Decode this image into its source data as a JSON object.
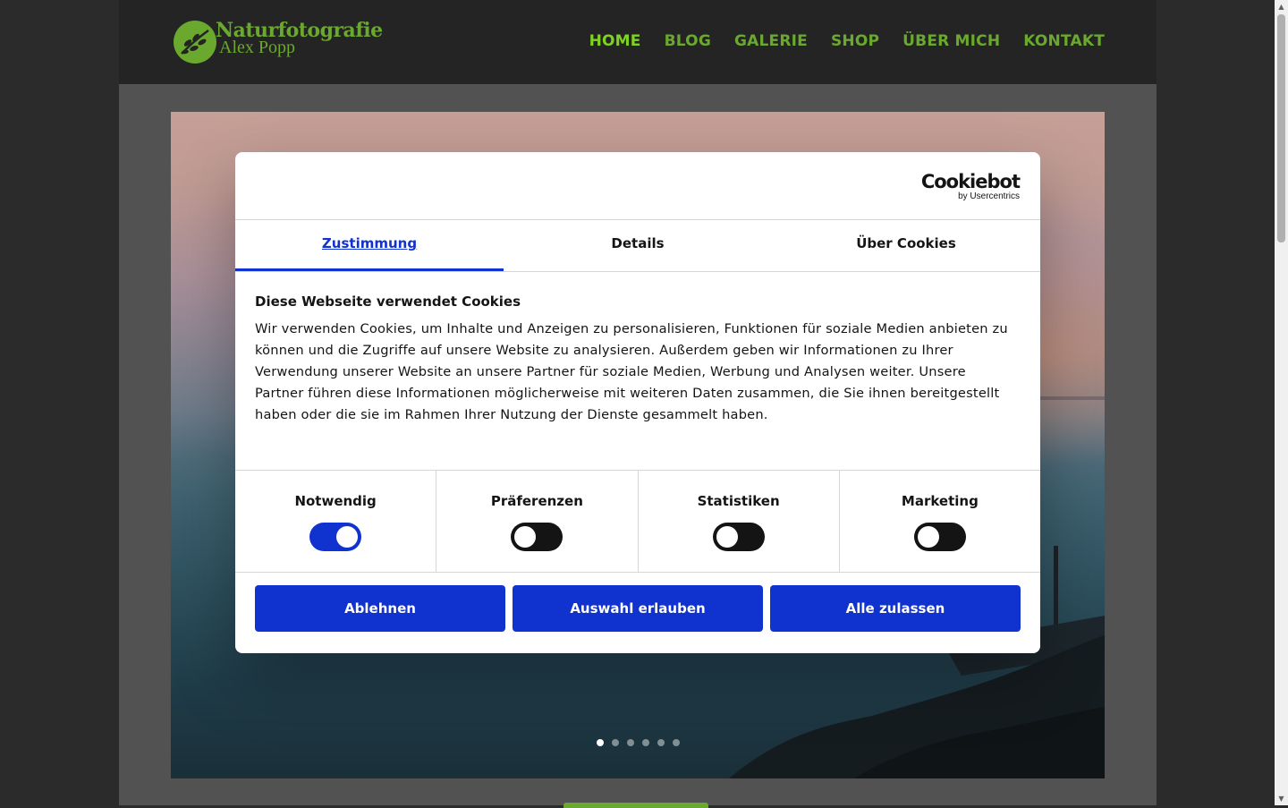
{
  "site": {
    "logo_title": "Naturfotografie",
    "logo_subtitle": "Alex Popp",
    "brand_color": "#6aa82e",
    "nav": [
      {
        "label": "HOME",
        "active": true
      },
      {
        "label": "BLOG"
      },
      {
        "label": "GALERIE"
      },
      {
        "label": "SHOP"
      },
      {
        "label": "ÜBER MICH"
      },
      {
        "label": "KONTAKT"
      }
    ]
  },
  "slider": {
    "slide_count": 6,
    "active_slide": 1
  },
  "cookie_dialog": {
    "brand_name": "Cookiebot",
    "brand_by": "by Usercentrics",
    "tabs": [
      {
        "label": "Zustimmung",
        "active": true
      },
      {
        "label": "Details"
      },
      {
        "label": "Über Cookies"
      }
    ],
    "title": "Diese Webseite verwendet Cookies",
    "text": "Wir verwenden Cookies, um Inhalte und Anzeigen zu personalisieren, Funktionen für soziale Medien anbieten zu können und die Zugriffe auf unsere Website zu analysieren. Außerdem geben wir Informationen zu Ihrer Verwendung unserer Website an unsere Partner für soziale Medien, Werbung und Analysen weiter. Unsere Partner führen diese Informationen möglicherweise mit weiteren Daten zusammen, die Sie ihnen bereitgestellt haben oder die sie im Rahmen Ihrer Nutzung der Dienste gesammelt haben.",
    "toggles": [
      {
        "label": "Notwendig",
        "on": true
      },
      {
        "label": "Präferenzen",
        "on": false
      },
      {
        "label": "Statistiken",
        "on": false
      },
      {
        "label": "Marketing",
        "on": false
      }
    ],
    "buttons": {
      "decline": "Ablehnen",
      "allow_selection": "Auswahl erlauben",
      "allow_all": "Alle zulassen"
    },
    "accent_color": "#1032cf"
  }
}
